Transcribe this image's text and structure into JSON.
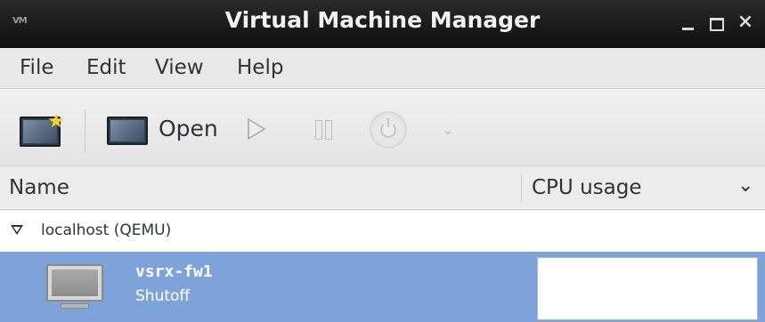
{
  "window": {
    "title": "Virtual Machine Manager",
    "icon_text": "VM",
    "controls": {
      "minimize": "minimize-icon",
      "maximize": "maximize-icon",
      "close": "×"
    }
  },
  "menubar": {
    "items": [
      {
        "label": "File"
      },
      {
        "label": "Edit"
      },
      {
        "label": "View"
      },
      {
        "label": "Help"
      }
    ]
  },
  "toolbar": {
    "new_icon": "new-vm-icon",
    "open_label": "Open",
    "run_icon": "play-icon",
    "pause_icon": "pause-icon",
    "shutdown_icon": "power-icon",
    "dropdown_icon": "⌄"
  },
  "columns": {
    "name": "Name",
    "cpu": "CPU usage",
    "chevron": "⌄"
  },
  "connections": [
    {
      "label": "localhost (QEMU)",
      "vms": [
        {
          "name": "vsrx-fw1",
          "status": "Shutoff",
          "selected": true
        }
      ]
    }
  ],
  "colors": {
    "selection": "#7ea3d9",
    "titlebar": "#1a1a1a",
    "star": "#f2d32a"
  }
}
